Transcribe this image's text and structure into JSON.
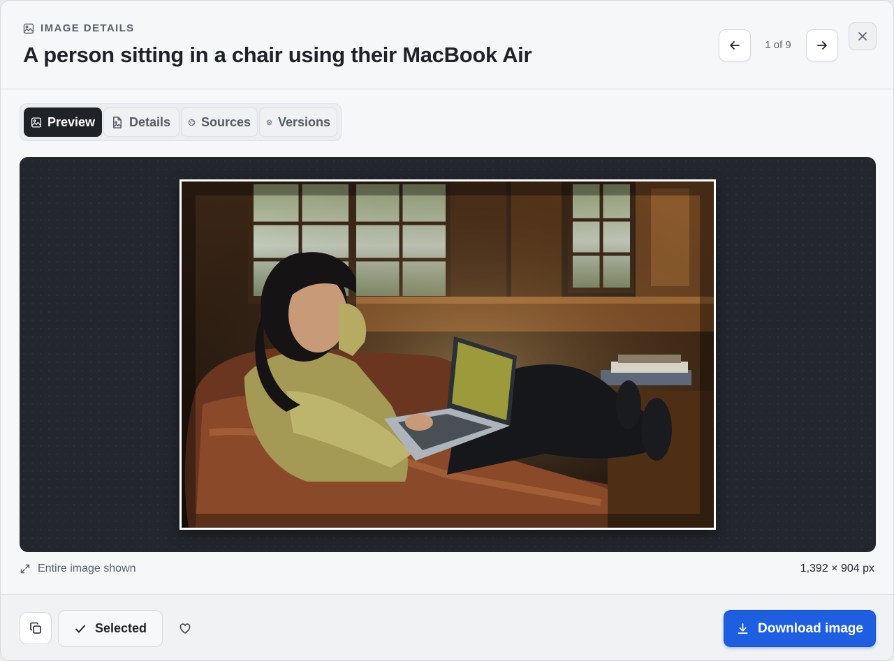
{
  "header": {
    "eyebrow": "IMAGE DETAILS",
    "title": "A person sitting in a chair using their MacBook Air",
    "counter": "1 of 9"
  },
  "tabs": [
    {
      "label": "Preview",
      "icon": "image-icon",
      "active": true
    },
    {
      "label": "Details",
      "icon": "file-image-icon",
      "active": false
    },
    {
      "label": "Sources",
      "icon": "globe-icon",
      "active": false
    },
    {
      "label": "Versions",
      "icon": "layers-icon",
      "active": false
    }
  ],
  "preview": {
    "status": "Entire image shown",
    "dimensions": "1,392 × 904 px"
  },
  "footer": {
    "selected_label": "Selected",
    "download_label": "Download image"
  },
  "colors": {
    "accent": "#1d5fe0",
    "active_tab": "#1f2328",
    "stage_bg": "#23272d"
  }
}
